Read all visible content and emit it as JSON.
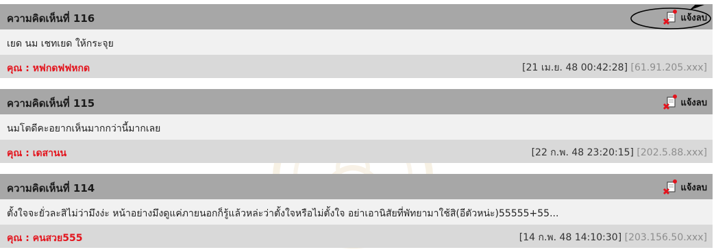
{
  "report_label": "แจ้งลบ",
  "author_prefix": "คุณ : ",
  "comments": [
    {
      "title": "ความคิดเห็นที่ 116",
      "text": "เยด นม เชทเยด ให้กระจุย",
      "author": "หฟกดฟฟหกด",
      "datetime": "[21 เม.ย. 48 00:42:28]",
      "ip": "[61.91.205.xxx]"
    },
    {
      "title": "ความคิดเห็นที่ 115",
      "text": "นมโตดีคะอยากเห็นมากกว่านี้มากเลย",
      "author": "เดสานน",
      "datetime": "[22 ก.พ. 48 23:20:15]",
      "ip": "[202.5.88.xxx]"
    },
    {
      "title": "ความคิดเห็นที่ 114",
      "text": "ตั้งใจจะยั่วละสิไม่ว่ามึงง่ะ หน้าอย่างมึงดูแค่ภายนอกก็รู้แล้วหล่ะว่าตั้งใจหรือไม่ตั้งใจ อย่าเอานิสัยที่พัทยามาใช้สิ(อีตัวหน่ะ)55555+55...",
      "author": "คนสวย555",
      "datetime": "[14 ก.พ. 48 14:10:30]",
      "ip": "[203.156.50.xxx]"
    }
  ]
}
